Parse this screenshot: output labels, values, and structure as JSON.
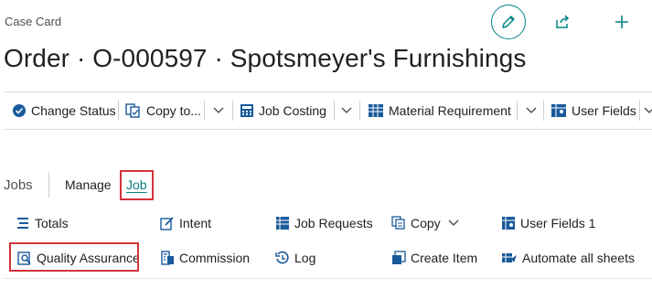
{
  "header": {
    "caption": "Case Card",
    "title": "Order · O-000597 · Spotsmeyer's Furnishings",
    "icons": [
      "pencil-icon",
      "share-icon",
      "plus-icon"
    ]
  },
  "actions": {
    "change_status": "Change Status",
    "copy_to": "Copy to...",
    "job_costing": "Job Costing",
    "material_requirement": "Material Requirement",
    "user_fields": "User Fields"
  },
  "tabs": {
    "group_label": "Jobs",
    "manage": "Manage",
    "job": "Job",
    "active": "Job"
  },
  "job_actions": {
    "totals": "Totals",
    "intent": "Intent",
    "job_requests": "Job Requests",
    "copy": "Copy",
    "user_fields_1": "User Fields 1",
    "quality_assurance": "Quality Assurance",
    "commission": "Commission",
    "log": "Log",
    "create_item": "Create Item",
    "automate_all_sheets": "Automate all sheets"
  },
  "colors": {
    "accent": "#008489",
    "highlight": "#d13438",
    "icon_blue": "#1a5a9c"
  }
}
